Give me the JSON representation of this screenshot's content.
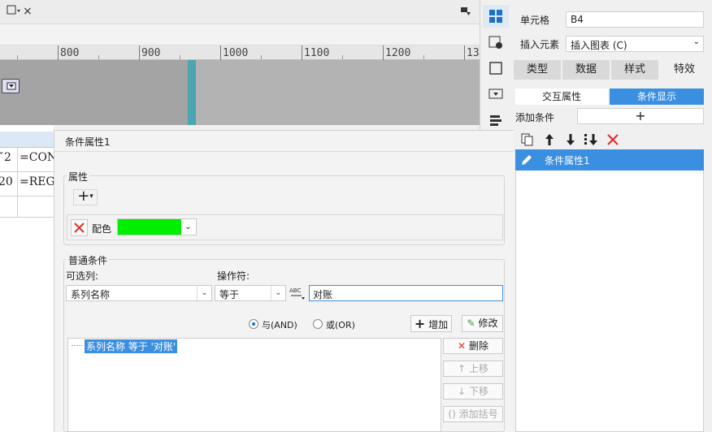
{
  "top": {
    "tab_close": "×"
  },
  "ruler": {
    "labels": [
      "800",
      "900",
      "1000",
      "1100",
      "1200",
      "13"
    ]
  },
  "sheet": {
    "cells": [
      "ˇ2",
      "=CONC",
      "20",
      "=REGE"
    ]
  },
  "right_panel": {
    "cell_label": "单元格",
    "cell_value": "B4",
    "insert_label": "插入元素",
    "insert_value": "插入图表 (C)",
    "tabs": [
      "类型",
      "数据",
      "样式",
      "特效"
    ],
    "subtabs": [
      "交互属性",
      "条件显示"
    ],
    "add_condition_label": "添加条件",
    "add_symbol": "+",
    "condition_items": [
      "条件属性1"
    ]
  },
  "dialog": {
    "title": "条件属性1",
    "attributes_label": "属性",
    "add_symbol": "+",
    "color_label": "配色",
    "color_value": "#00ee00",
    "general_label": "普通条件",
    "optional_column_label": "可选列:",
    "operator_label": "操作符:",
    "column_value": "系列名称",
    "operator_value": "等于",
    "value_input": "对账",
    "and_label": "与(AND)",
    "or_label": "或(OR)",
    "add_button": "增加",
    "modify_button": "修改",
    "condition_expression": "系列名称 等于 '对账'",
    "delete_button": "删除",
    "up_button": "上移",
    "down_button": "下移",
    "add_bracket_button": "添加括号"
  },
  "colors": {
    "accent": "#3b8fe0",
    "green": "#00ee00",
    "red": "#e03030"
  }
}
